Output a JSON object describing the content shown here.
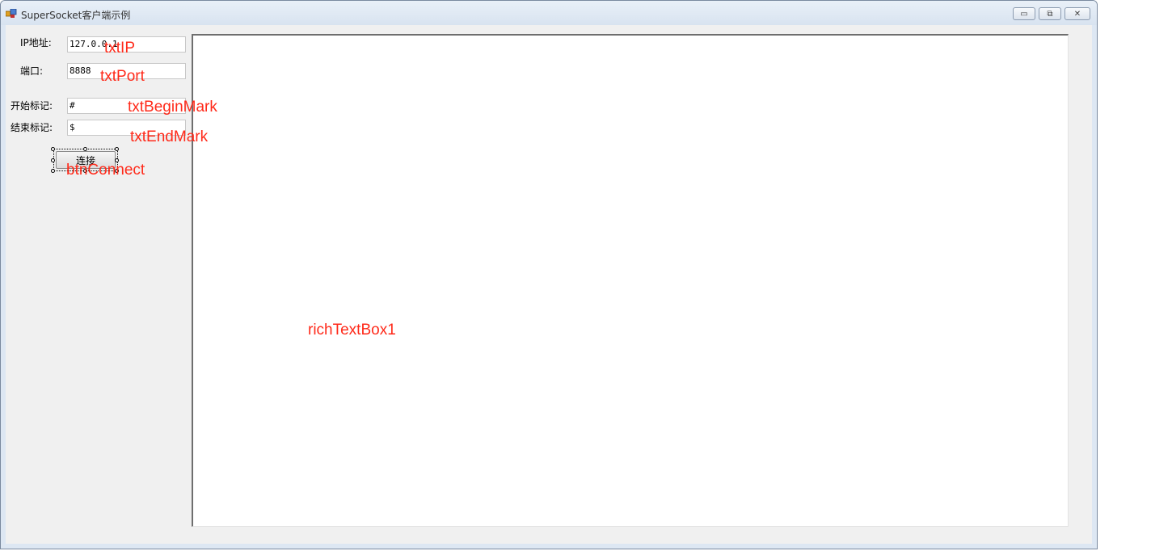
{
  "window": {
    "title": "SuperSocket客户端示例",
    "minimize_glyph": "▭",
    "maximize_glyph": "⧉",
    "close_glyph": "✕"
  },
  "form": {
    "ip_label": "IP地址:",
    "ip_value": "127.0.0.1",
    "port_label": "端口:",
    "port_value": "8888",
    "begin_mark_label": "开始标记:",
    "begin_mark_value": "#",
    "end_mark_label": "结束标记:",
    "end_mark_value": "$",
    "connect_label": "连接"
  },
  "annotations": {
    "txt_ip": "txtIP",
    "txt_port": "txtPort",
    "txt_begin_mark": "txtBeginMark",
    "txt_end_mark": "txtEndMark",
    "btn_connect": "btnConnect",
    "rich_text_box": "richTextBox1"
  },
  "colors": {
    "annotation": "#ff2a1a",
    "client_bg": "#f0f0f0",
    "titlebar": "#dde7f3"
  }
}
